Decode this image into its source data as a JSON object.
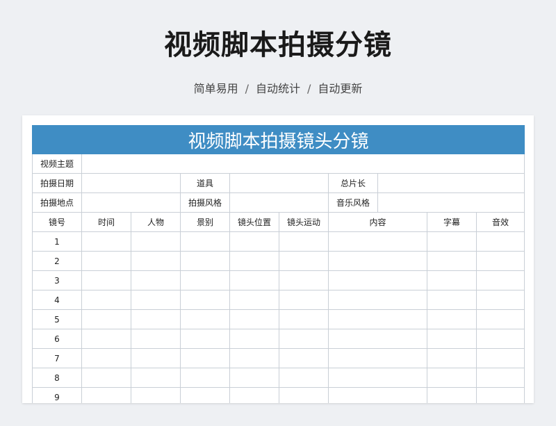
{
  "page": {
    "title": "视频脚本拍摄分镜",
    "subtitle": [
      "简单易用",
      "自动统计",
      "自动更新"
    ],
    "subtitle_separator": "/"
  },
  "sheet": {
    "banner": "视频脚本拍摄镜头分镜",
    "info": {
      "theme_label": "视频主题",
      "date_label": "拍摄日期",
      "props_label": "道具",
      "duration_label": "总片长",
      "location_label": "拍摄地点",
      "style_label": "拍摄风格",
      "music_label": "音乐风格"
    },
    "columns": [
      "镜号",
      "时间",
      "人物",
      "景别",
      "镜头位置",
      "镜头运动",
      "内容",
      "字幕",
      "音效"
    ],
    "rows": [
      "1",
      "2",
      "3",
      "4",
      "5",
      "6",
      "7",
      "8",
      "9"
    ]
  },
  "colors": {
    "banner_bg": "#3f8dc4",
    "grid": "#c9cfd6",
    "page_bg": "#eef0f3"
  }
}
